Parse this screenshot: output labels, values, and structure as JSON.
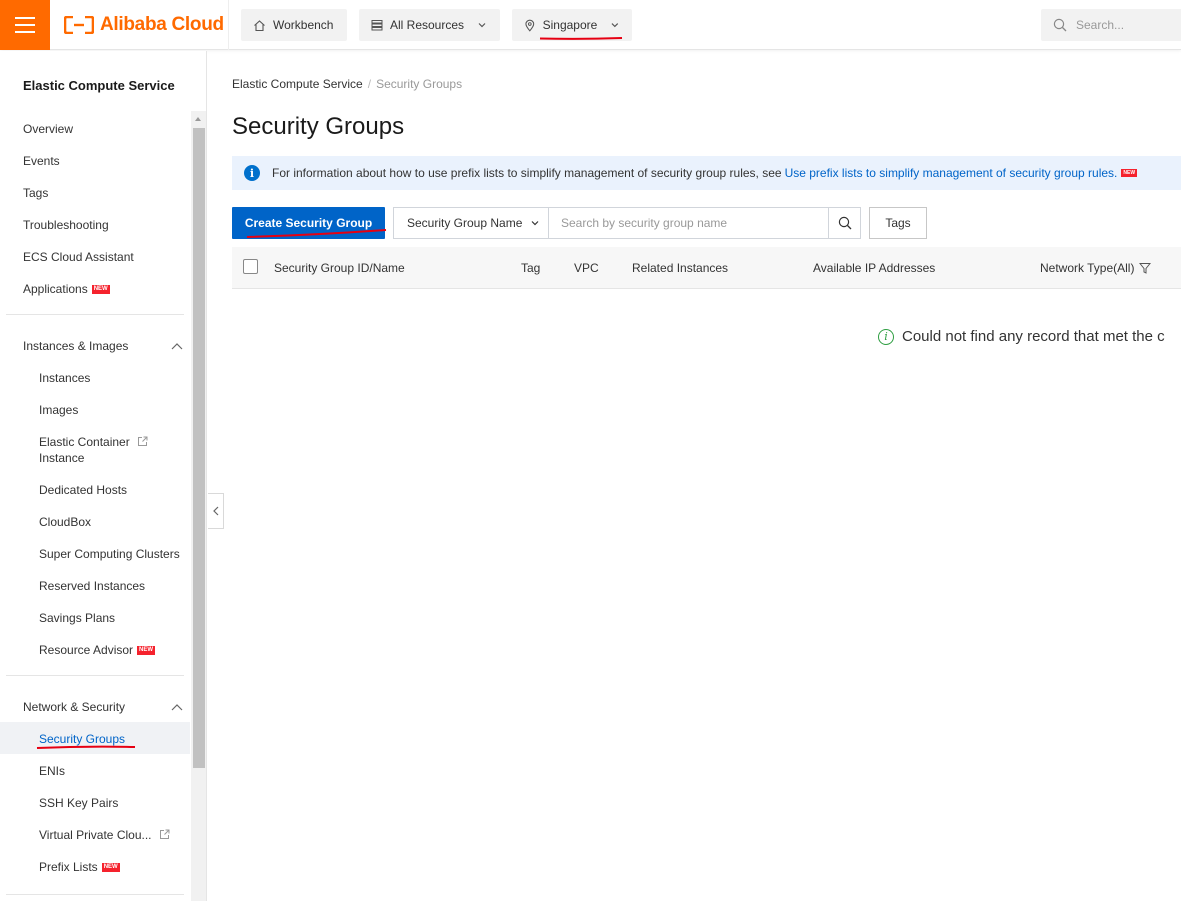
{
  "header": {
    "brand": "Alibaba Cloud",
    "workbench": "Workbench",
    "all_resources": "All Resources",
    "region": "Singapore",
    "search_placeholder": "Search..."
  },
  "sidebar": {
    "title": "Elastic Compute Service",
    "top_items": [
      "Overview",
      "Events",
      "Tags",
      "Troubleshooting",
      "ECS Cloud Assistant",
      "Applications"
    ],
    "group1": {
      "label": "Instances & Images",
      "items": [
        "Instances",
        "Images",
        "Elastic Container",
        "Instance",
        "Dedicated Hosts",
        "CloudBox",
        "Super Computing Clusters",
        "Reserved Instances",
        "Savings Plans",
        "Resource Advisor"
      ]
    },
    "group2": {
      "label": "Network & Security",
      "items": [
        "Security Groups",
        "ENIs",
        "SSH Key Pairs",
        "Virtual Private Clou...",
        "Prefix Lists"
      ]
    },
    "new_badge": "NEW"
  },
  "main": {
    "breadcrumb": [
      "Elastic Compute Service",
      "Security Groups"
    ],
    "breadcrumb_sep": "/",
    "title": "Security Groups",
    "info_text": "For information about how to use prefix lists to simplify management of security group rules, see",
    "info_link": "Use prefix lists to simplify management of security group rules.",
    "create_button": "Create Security Group",
    "filter_select": "Security Group Name",
    "filter_placeholder": "Search by security group name",
    "tags_button": "Tags",
    "columns": [
      "Security Group ID/Name",
      "Tag",
      "VPC",
      "Related Instances",
      "Available IP Addresses",
      "Network Type(All)"
    ],
    "empty_message": "Could not find any record that met the c"
  },
  "colors": {
    "brand": "#ff6a00",
    "primary": "#0064c8",
    "annotation": "#e60012"
  }
}
